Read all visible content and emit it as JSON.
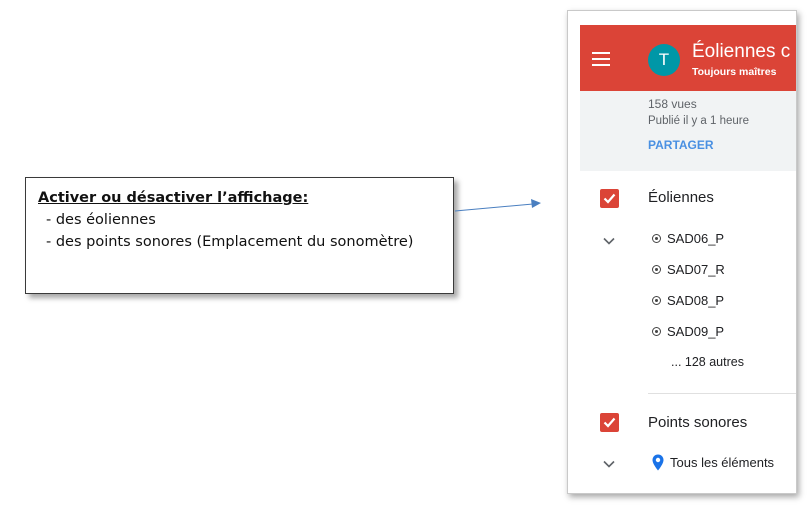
{
  "callout": {
    "title": "Activer ou désactiver l’affichage:",
    "lines": [
      "- des éoliennes",
      "- des points sonores (Emplacement du sonomètre)"
    ]
  },
  "map": {
    "avatar_letter": "T",
    "title": "Éoliennes c",
    "subtitle": "Toujours maîtres",
    "views": "158 vues",
    "published": "Publié il y a 1 heure",
    "share_label": "PARTAGER",
    "layers": [
      {
        "name": "Éoliennes",
        "checked": true,
        "features": [
          "SAD06_P",
          "SAD07_R",
          "SAD08_P",
          "SAD09_P"
        ],
        "more": "... 128 autres"
      },
      {
        "name": "Points sonores",
        "checked": true,
        "all_items": "Tous les éléments"
      }
    ]
  },
  "colors": {
    "header": "#db4437",
    "checkbox": "#db4437",
    "avatar": "#0097a7",
    "share": "#4a90e2",
    "pin": "#1a73e8"
  }
}
